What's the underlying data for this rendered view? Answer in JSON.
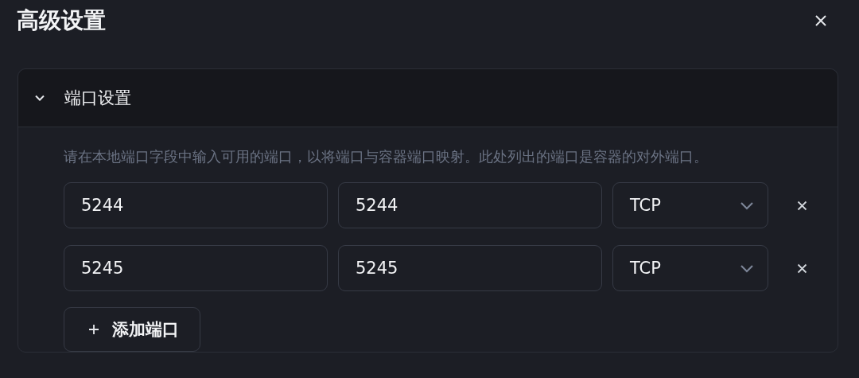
{
  "dialog": {
    "title": "高级设置"
  },
  "section": {
    "title": "端口设置",
    "expanded": true,
    "description": "请在本地端口字段中输入可用的端口，以将端口与容器端口映射。此处列出的端口是容器的对外端口。",
    "ports": [
      {
        "local": "5244",
        "container": "5244",
        "protocol": "TCP"
      },
      {
        "local": "5245",
        "container": "5245",
        "protocol": "TCP"
      }
    ],
    "add_button": "添加端口"
  }
}
